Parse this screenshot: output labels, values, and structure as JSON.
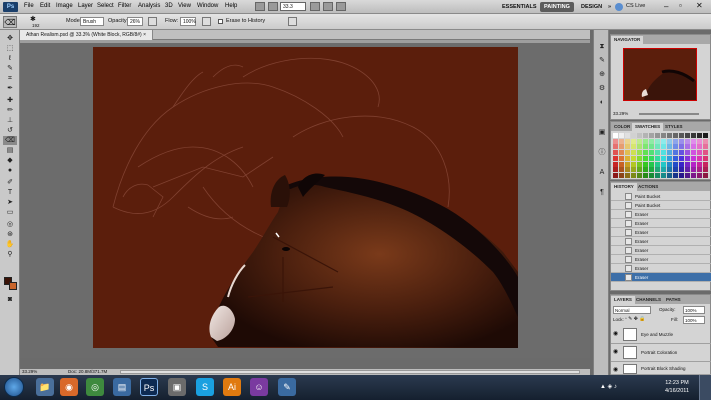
{
  "app": {
    "logo": "Ps"
  },
  "menu": {
    "items": [
      "File",
      "Edit",
      "Image",
      "Layer",
      "Select",
      "Filter",
      "Analysis",
      "3D",
      "View",
      "Window",
      "Help"
    ]
  },
  "workspace": {
    "zoom_box": "33.3",
    "essentials": "ESSENTIALS",
    "painting": "PAINTING",
    "design": "DESIGN",
    "more": "»",
    "cslive": "CS Live"
  },
  "options": {
    "brush_size": "192",
    "mode_label": "Mode:",
    "mode_value": "Brush",
    "opacity_label": "Opacity:",
    "opacity_value": "26%",
    "flow_label": "Flow:",
    "flow_value": "100%",
    "erase_history": "Erase to History"
  },
  "document": {
    "tab_title": "Athan Realism.psd @ 33.3% (White Block, RGB/8#)",
    "zoom": "33.29%",
    "doc_info": "Doc: 20.8M/371.7M"
  },
  "navigator": {
    "tab": "NAVIGATOR",
    "zoom": "33.29%"
  },
  "swatches": {
    "tabs": [
      "COLOR",
      "SWATCHES",
      "STYLES"
    ]
  },
  "history": {
    "tabs": [
      "HISTORY",
      "ACTIONS"
    ],
    "items": [
      "Paint Bucket",
      "Paint Bucket",
      "Eraser",
      "Eraser",
      "Eraser",
      "Eraser",
      "Eraser",
      "Eraser",
      "Eraser",
      "Eraser"
    ]
  },
  "layers": {
    "tabs": [
      "LAYERS",
      "CHANNELS",
      "PATHS"
    ],
    "blend_mode": "Normal",
    "opacity_label": "Opacity:",
    "opacity_value": "100%",
    "lock_label": "Lock:",
    "fill_label": "Fill:",
    "fill_value": "100%",
    "items": [
      "Eye and Muzzle",
      "Portrait Coloration",
      "Portrait Block Shading"
    ]
  },
  "taskbar": {
    "time": "12:23 PM",
    "date": "4/16/2011"
  },
  "colors": {
    "canvas_bg": "#5b1e0c",
    "accent": "#3d6fa8"
  }
}
